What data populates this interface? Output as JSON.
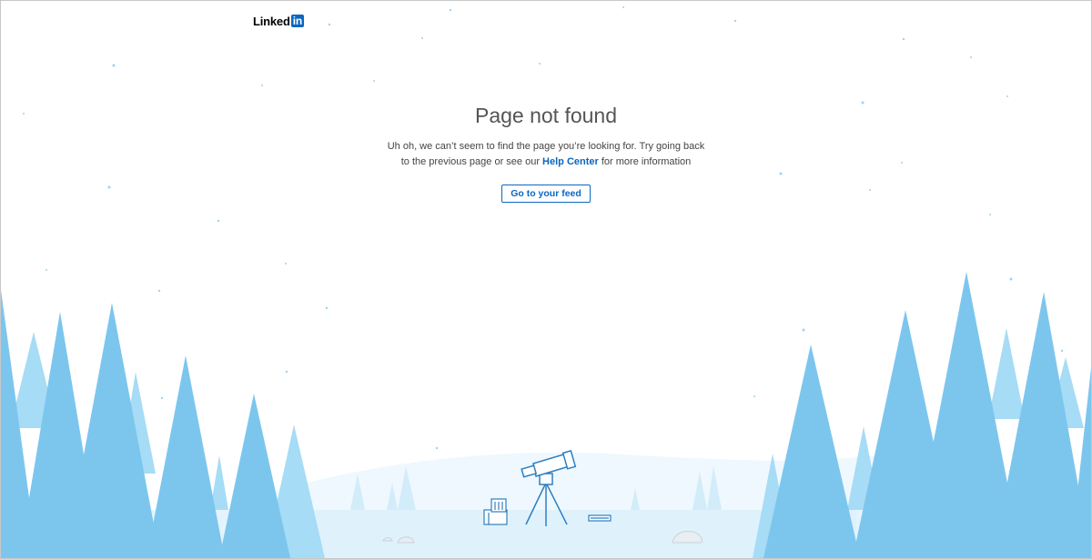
{
  "header": {
    "logo_text": "Linked",
    "logo_box_text": "in",
    "brand_color": "#0a66c2"
  },
  "main": {
    "title": "Page not found",
    "message_part1": "Uh oh, we can’t seem to find the page you’re looking for. Try going back to the previous page or see our ",
    "help_link_label": "Help Center",
    "message_part2": " for more information",
    "button_label": "Go to your feed"
  },
  "illustration": {
    "icons": [
      "telescope-icon",
      "trees",
      "stars",
      "book-icon",
      "document-icon",
      "rock-icon"
    ],
    "colors": {
      "tree_dark": "#7cc6ee",
      "tree_light": "#a6dcf5",
      "hill": "#eaf6fd",
      "ground": "#d4eefb",
      "outline": "#2e7fc0"
    }
  }
}
